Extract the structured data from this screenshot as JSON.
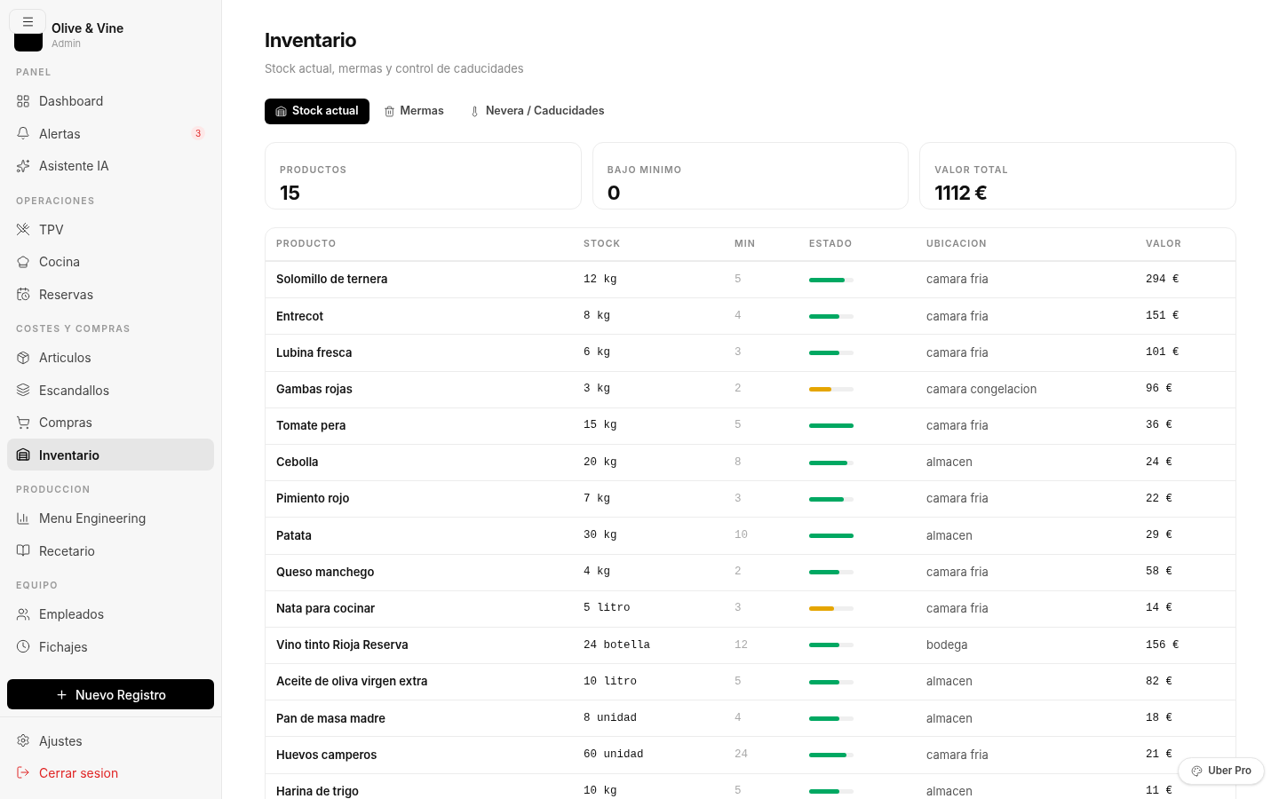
{
  "sidebar": {
    "brand": {
      "name": "Olive & Vine",
      "role": "Admin"
    },
    "sections": [
      {
        "title": "PANEL",
        "items": [
          {
            "label": "Dashboard",
            "selected": false
          },
          {
            "label": "Alertas",
            "selected": false,
            "badge": "3"
          },
          {
            "label": "Asistente IA",
            "selected": false
          }
        ]
      },
      {
        "title": "OPERACIONES",
        "items": [
          {
            "label": "TPV",
            "selected": false
          },
          {
            "label": "Cocina",
            "selected": false
          },
          {
            "label": "Reservas",
            "selected": false
          }
        ]
      },
      {
        "title": "COSTES Y COMPRAS",
        "items": [
          {
            "label": "Articulos",
            "selected": false
          },
          {
            "label": "Escandallos",
            "selected": false
          },
          {
            "label": "Compras",
            "selected": false
          },
          {
            "label": "Inventario",
            "selected": true
          }
        ]
      },
      {
        "title": "PRODUCCION",
        "items": [
          {
            "label": "Menu Engineering",
            "selected": false
          },
          {
            "label": "Recetario",
            "selected": false
          }
        ]
      },
      {
        "title": "EQUIPO",
        "items": [
          {
            "label": "Empleados",
            "selected": false
          },
          {
            "label": "Fichajes",
            "selected": false
          }
        ]
      }
    ],
    "new_button": "Nuevo Registro",
    "footer": [
      {
        "label": "Ajustes",
        "kind": "normal"
      },
      {
        "label": "Cerrar sesion",
        "kind": "danger"
      }
    ]
  },
  "page": {
    "title": "Inventario",
    "subtitle": "Stock actual, mermas y control de caducidades"
  },
  "tabs": [
    {
      "label": "Stock actual",
      "selected": true
    },
    {
      "label": "Mermas",
      "selected": false
    },
    {
      "label": "Nevera / Caducidades",
      "selected": false
    }
  ],
  "stats": [
    {
      "label": "PRODUCTOS",
      "value": "15"
    },
    {
      "label": "BAJO MINIMO",
      "value": "0"
    },
    {
      "label": "VALOR TOTAL",
      "value": "1112 €"
    }
  ],
  "table": {
    "columns": [
      "PRODUCTO",
      "STOCK",
      "MIN",
      "ESTADO",
      "UBICACION",
      "VALOR"
    ],
    "rows": [
      {
        "product": "Solomillo de ternera",
        "stock": "12 kg",
        "min": "5",
        "level": 0.8,
        "color": "#00a862",
        "location": "camara fria",
        "value": "294 €"
      },
      {
        "product": "Entrecot",
        "stock": "8 kg",
        "min": "4",
        "level": 0.67,
        "color": "#00a862",
        "location": "camara fria",
        "value": "151 €"
      },
      {
        "product": "Lubina fresca",
        "stock": "6 kg",
        "min": "3",
        "level": 0.67,
        "color": "#00a862",
        "location": "camara fria",
        "value": "101 €"
      },
      {
        "product": "Gambas rojas",
        "stock": "3 kg",
        "min": "2",
        "level": 0.5,
        "color": "#e5a500",
        "location": "camara congelacion",
        "value": "96 €"
      },
      {
        "product": "Tomate pera",
        "stock": "15 kg",
        "min": "5",
        "level": 1,
        "color": "#00a862",
        "location": "camara fria",
        "value": "36 €"
      },
      {
        "product": "Cebolla",
        "stock": "20 kg",
        "min": "8",
        "level": 0.85,
        "color": "#00a862",
        "location": "almacen",
        "value": "24 €"
      },
      {
        "product": "Pimiento rojo",
        "stock": "7 kg",
        "min": "3",
        "level": 0.78,
        "color": "#00a862",
        "location": "camara fria",
        "value": "22 €"
      },
      {
        "product": "Patata",
        "stock": "30 kg",
        "min": "10",
        "level": 1,
        "color": "#00a862",
        "location": "almacen",
        "value": "29 €"
      },
      {
        "product": "Queso manchego",
        "stock": "4 kg",
        "min": "2",
        "level": 0.67,
        "color": "#00a862",
        "location": "camara fria",
        "value": "58 €"
      },
      {
        "product": "Nata para cocinar",
        "stock": "5 litro",
        "min": "3",
        "level": 0.56,
        "color": "#e5a500",
        "location": "camara fria",
        "value": "14 €"
      },
      {
        "product": "Vino tinto Rioja Reserva",
        "stock": "24 botella",
        "min": "12",
        "level": 0.67,
        "color": "#00a862",
        "location": "bodega",
        "value": "156 €"
      },
      {
        "product": "Aceite de oliva virgen extra",
        "stock": "10 litro",
        "min": "5",
        "level": 0.67,
        "color": "#00a862",
        "location": "almacen",
        "value": "82 €"
      },
      {
        "product": "Pan de masa madre",
        "stock": "8 unidad",
        "min": "4",
        "level": 0.67,
        "color": "#00a862",
        "location": "almacen",
        "value": "18 €"
      },
      {
        "product": "Huevos camperos",
        "stock": "60 unidad",
        "min": "24",
        "level": 0.83,
        "color": "#00a862",
        "location": "camara fria",
        "value": "21 €"
      },
      {
        "product": "Harina de trigo",
        "stock": "10 kg",
        "min": "5",
        "level": 0.67,
        "color": "#00a862",
        "location": "almacen",
        "value": "11 €"
      }
    ]
  },
  "floating_button": "Uber Pro"
}
